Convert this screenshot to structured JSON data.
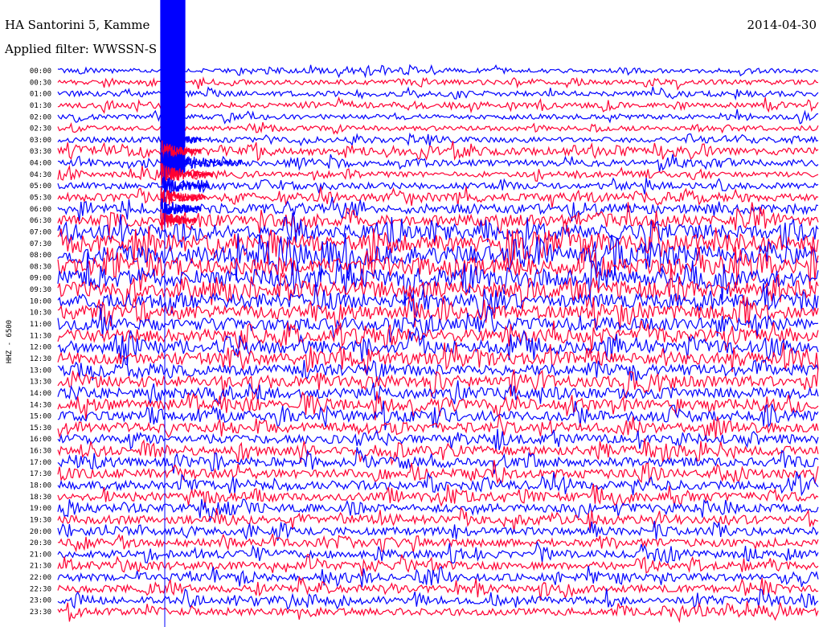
{
  "header": {
    "station_title": "HA Santorini 5, Kamme",
    "filter_label": "Applied filter: WWSSN-S",
    "date": "2014-04-30"
  },
  "chart_data": {
    "type": "line",
    "plot_kind": "helicorder",
    "ylabel": "HHZ - 6500",
    "row_labels": [
      "00:00",
      "00:30",
      "01:00",
      "01:30",
      "02:00",
      "02:30",
      "03:00",
      "03:30",
      "04:00",
      "04:30",
      "05:00",
      "05:30",
      "06:00",
      "06:30",
      "07:00",
      "07:30",
      "08:00",
      "08:30",
      "09:00",
      "09:30",
      "10:00",
      "10:30",
      "11:00",
      "11:30",
      "12:00",
      "12:30",
      "13:00",
      "13:30",
      "14:00",
      "14:30",
      "15:00",
      "15:30",
      "16:00",
      "16:30",
      "17:00",
      "17:30",
      "18:00",
      "18:30",
      "19:00",
      "19:30",
      "20:00",
      "20:30",
      "21:00",
      "21:30",
      "22:00",
      "22:30",
      "23:00",
      "23:30"
    ],
    "series_colors": [
      "#0000ff",
      "#ff0033"
    ],
    "relative_amplitude_by_row": [
      0.5,
      0.55,
      0.6,
      0.6,
      0.55,
      0.55,
      0.6,
      0.8,
      0.7,
      0.6,
      0.7,
      0.9,
      1.1,
      1.2,
      1.6,
      1.9,
      2.0,
      2.0,
      1.9,
      1.8,
      1.6,
      1.5,
      1.4,
      1.4,
      1.4,
      1.3,
      1.2,
      1.2,
      1.2,
      1.1,
      1.1,
      1.1,
      1.0,
      1.0,
      1.0,
      1.0,
      0.95,
      0.95,
      0.9,
      0.9,
      0.85,
      0.85,
      0.85,
      0.85,
      0.8,
      0.8,
      0.8,
      0.8
    ],
    "event": {
      "type": "large earthquake arrival",
      "start_row": "03:00",
      "end_row": "06:30",
      "peak_row": "04:00"
    },
    "duration_per_row_minutes": 30
  }
}
